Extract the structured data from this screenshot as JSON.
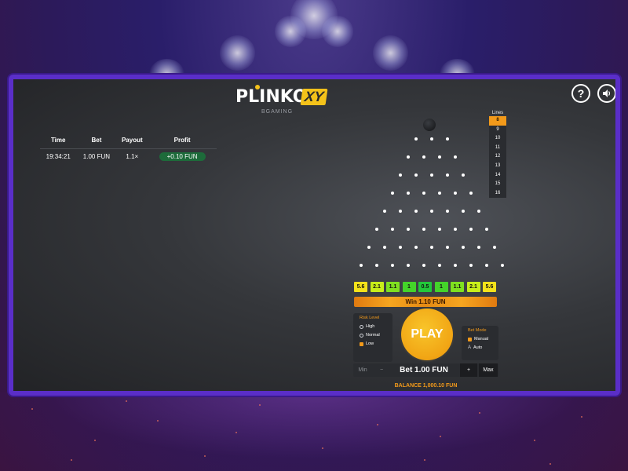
{
  "app": {
    "logo_text": "PLINKO",
    "logo_badge": "XY",
    "logo_sub": "BGAMING"
  },
  "controls_top": {
    "help_icon": "?",
    "sound_icon": "🔊"
  },
  "history": {
    "columns": [
      "Time",
      "Bet",
      "Payout",
      "Profit"
    ],
    "rows": [
      {
        "time": "19:34:21",
        "bet": "1.00 FUN",
        "payout": "1.1×",
        "profit": "+0.10 FUN"
      }
    ]
  },
  "lines": {
    "title": "Lines",
    "options": [
      "8",
      "9",
      "10",
      "11",
      "12",
      "13",
      "14",
      "15",
      "16"
    ],
    "selected": "8"
  },
  "multipliers": [
    "5.6",
    "2.1",
    "1.1",
    "1",
    "0.5",
    "1",
    "1.1",
    "2.1",
    "5.6"
  ],
  "multiplier_colors": [
    "#f4e21a",
    "#c8ee1a",
    "#7fe020",
    "#44d42a",
    "#22c83a",
    "#44d42a",
    "#7fe020",
    "#c8ee1a",
    "#f4e21a"
  ],
  "win_text": "Win 1.10 FUN",
  "risk": {
    "title": "Risk Level",
    "options": [
      "High",
      "Normal",
      "Low"
    ],
    "selected": "Low"
  },
  "play_label": "PLAY",
  "bet_mode": {
    "title": "Bet Mode",
    "options": [
      "Manual",
      "Auto"
    ],
    "selected": "Manual"
  },
  "bet": {
    "min_label": "Min",
    "minus_label": "−",
    "value": "Bet 1.00 FUN",
    "plus_label": "+",
    "max_label": "Max"
  },
  "balance_text": "BALANCE 1,000.10 FUN",
  "colors": {
    "accent": "#f39a1a",
    "frame": "#5a2ec8",
    "profit_pill": "#1d6b3a"
  }
}
